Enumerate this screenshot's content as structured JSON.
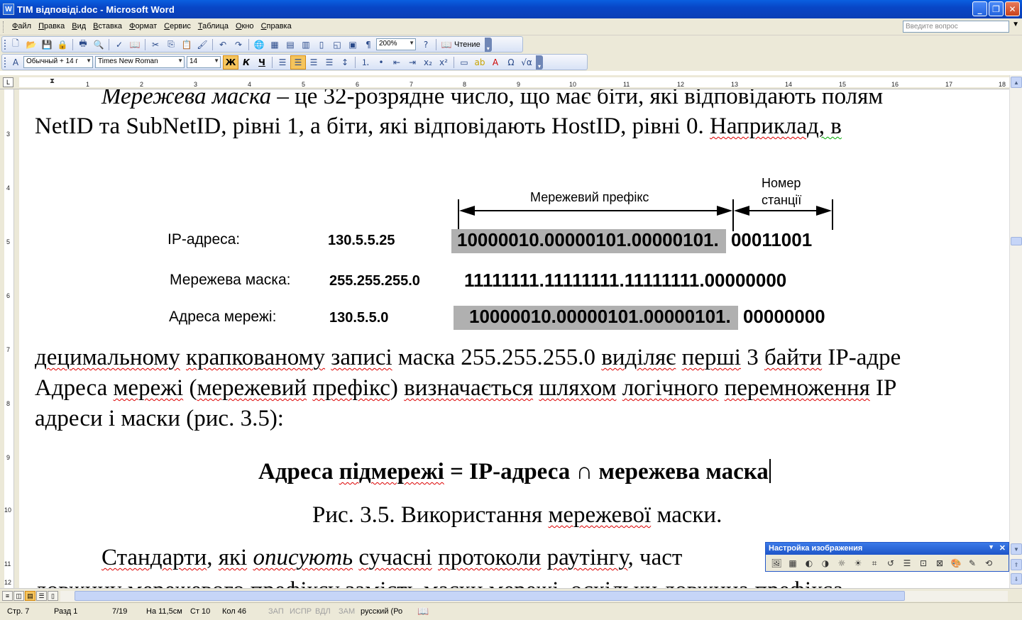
{
  "window": {
    "title": "ТІМ відповіді.doc - Microsoft Word",
    "app_icon": "W",
    "minimize_glyph": "_",
    "restore_glyph": "❐",
    "close_glyph": "✕"
  },
  "menu": {
    "items": [
      {
        "acc": "Ф",
        "rest": "айл"
      },
      {
        "acc": "П",
        "rest": "равка"
      },
      {
        "acc": "В",
        "rest": "ид"
      },
      {
        "acc": "В",
        "rest": "ставка"
      },
      {
        "acc": "Ф",
        "rest": "ормат"
      },
      {
        "acc": "С",
        "rest": "ервис"
      },
      {
        "acc": "Т",
        "rest": "аблица"
      },
      {
        "acc": "О",
        "rest": "кно"
      },
      {
        "acc": "С",
        "rest": "правка"
      }
    ],
    "help_placeholder": "Введите вопрос"
  },
  "toolbar_standard": {
    "zoom": "200%",
    "reading_label": "Чтение"
  },
  "toolbar_format": {
    "style": "Обычный + 14 г",
    "font": "Times New Roman",
    "size": "14",
    "bold": "Ж",
    "italic": "К",
    "underline": "Ч"
  },
  "ruler": {
    "corner": "L",
    "numbers": [
      "1",
      "2",
      "3",
      "4",
      "5",
      "6",
      "7",
      "8",
      "9",
      "10",
      "11",
      "12",
      "13",
      "14",
      "15",
      "16",
      "17",
      "18"
    ],
    "v_numbers": [
      "3",
      "4",
      "5",
      "6",
      "7",
      "8",
      "9",
      "10",
      "11",
      "12"
    ]
  },
  "document": {
    "p1_line1_italic": "Мережева маска",
    "p1_line1_rest": " – це 32-розрядне число, що має біти, які відповідають полям",
    "p1_line2_a": "NetID та SubNetID, рівні 1, а біти, які відповідають HostID, рівні 0. ",
    "p1_line2_b": "Наприклад",
    "p1_line2_c": ", в",
    "figure": {
      "header_prefix": "Мережевий префікс",
      "header_host_line1": "Номер",
      "header_host_line2": "станції",
      "rows": [
        {
          "label": "IP-адреса:",
          "value": "130.5.5.25",
          "bits_grey": "10000010.00000101.00000101.",
          "bits_rest": " 00011001"
        },
        {
          "label": "Мережева маска:",
          "value": "255.255.255.0",
          "bits_grey": "",
          "bits_rest": "11111111.11111111.11111111.00000000"
        },
        {
          "label": "Адреса мережі:",
          "value": "130.5.5.0",
          "bits_grey": "10000010.00000101.00000101.",
          "bits_rest": " 00000000"
        }
      ]
    },
    "p2_line1_a": "децимальному",
    "p2_line1_b": " ",
    "p2_line1_c": "крапкованому",
    "p2_line1_d": " ",
    "p2_line1_e": "записі",
    "p2_line1_f": " маска 255.255.255.0 ",
    "p2_line1_g": "виділяє",
    "p2_line1_h": " ",
    "p2_line1_i": "перші",
    "p2_line1_j": " 3 ",
    "p2_line1_k": "байти",
    "p2_line1_l": " IP-адре",
    "p2_line2_a": "Адреса ",
    "p2_line2_b": "мережі",
    "p2_line2_c": " (",
    "p2_line2_d": "мережевий",
    "p2_line2_e": " ",
    "p2_line2_f": "префікс",
    "p2_line2_g": ") ",
    "p2_line2_h": "визначається",
    "p2_line2_i": " ",
    "p2_line2_j": "шляхом",
    "p2_line2_k": " ",
    "p2_line2_l": "логічного",
    "p2_line2_m": " ",
    "p2_line2_n": "перемноження",
    "p2_line2_o": " IP",
    "p2_line3": "адреси і маски (рис. 3.5):",
    "formula_a": "Адреса ",
    "formula_b": "підмережі",
    "formula_c": " = IP-адреса ∩ мережева маска",
    "caption_a": "Рис. 3.5. Використання ",
    "caption_b": "мережевої",
    "caption_c": " маски.",
    "p3_line1_a": "Стандарти",
    "p3_line1_b": ", ",
    "p3_line1_c": "які",
    "p3_line1_d": " ",
    "p3_line1_e": "описують",
    "p3_line1_f": " ",
    "p3_line1_g": "сучасні",
    "p3_line1_h": " ",
    "p3_line1_i": "протоколи",
    "p3_line1_j": " ",
    "p3_line1_k": "раутінгу",
    "p3_line1_l": ", част",
    "p3_line2": "довжину мережевого префіксу замість маски мережі, оскільки довжина префікса"
  },
  "picture_toolbar": {
    "title": "Настройка изображения"
  },
  "statusbar": {
    "page": "Стр. 7",
    "section": "Разд 1",
    "pages": "7/19",
    "at": "На 11,5см",
    "line": "Ст 10",
    "col": "Кол 46",
    "rec": "ЗАП",
    "trk": "ИСПР",
    "ext": "ВДЛ",
    "ovr": "ЗАМ",
    "lang": "русский (Ро"
  }
}
